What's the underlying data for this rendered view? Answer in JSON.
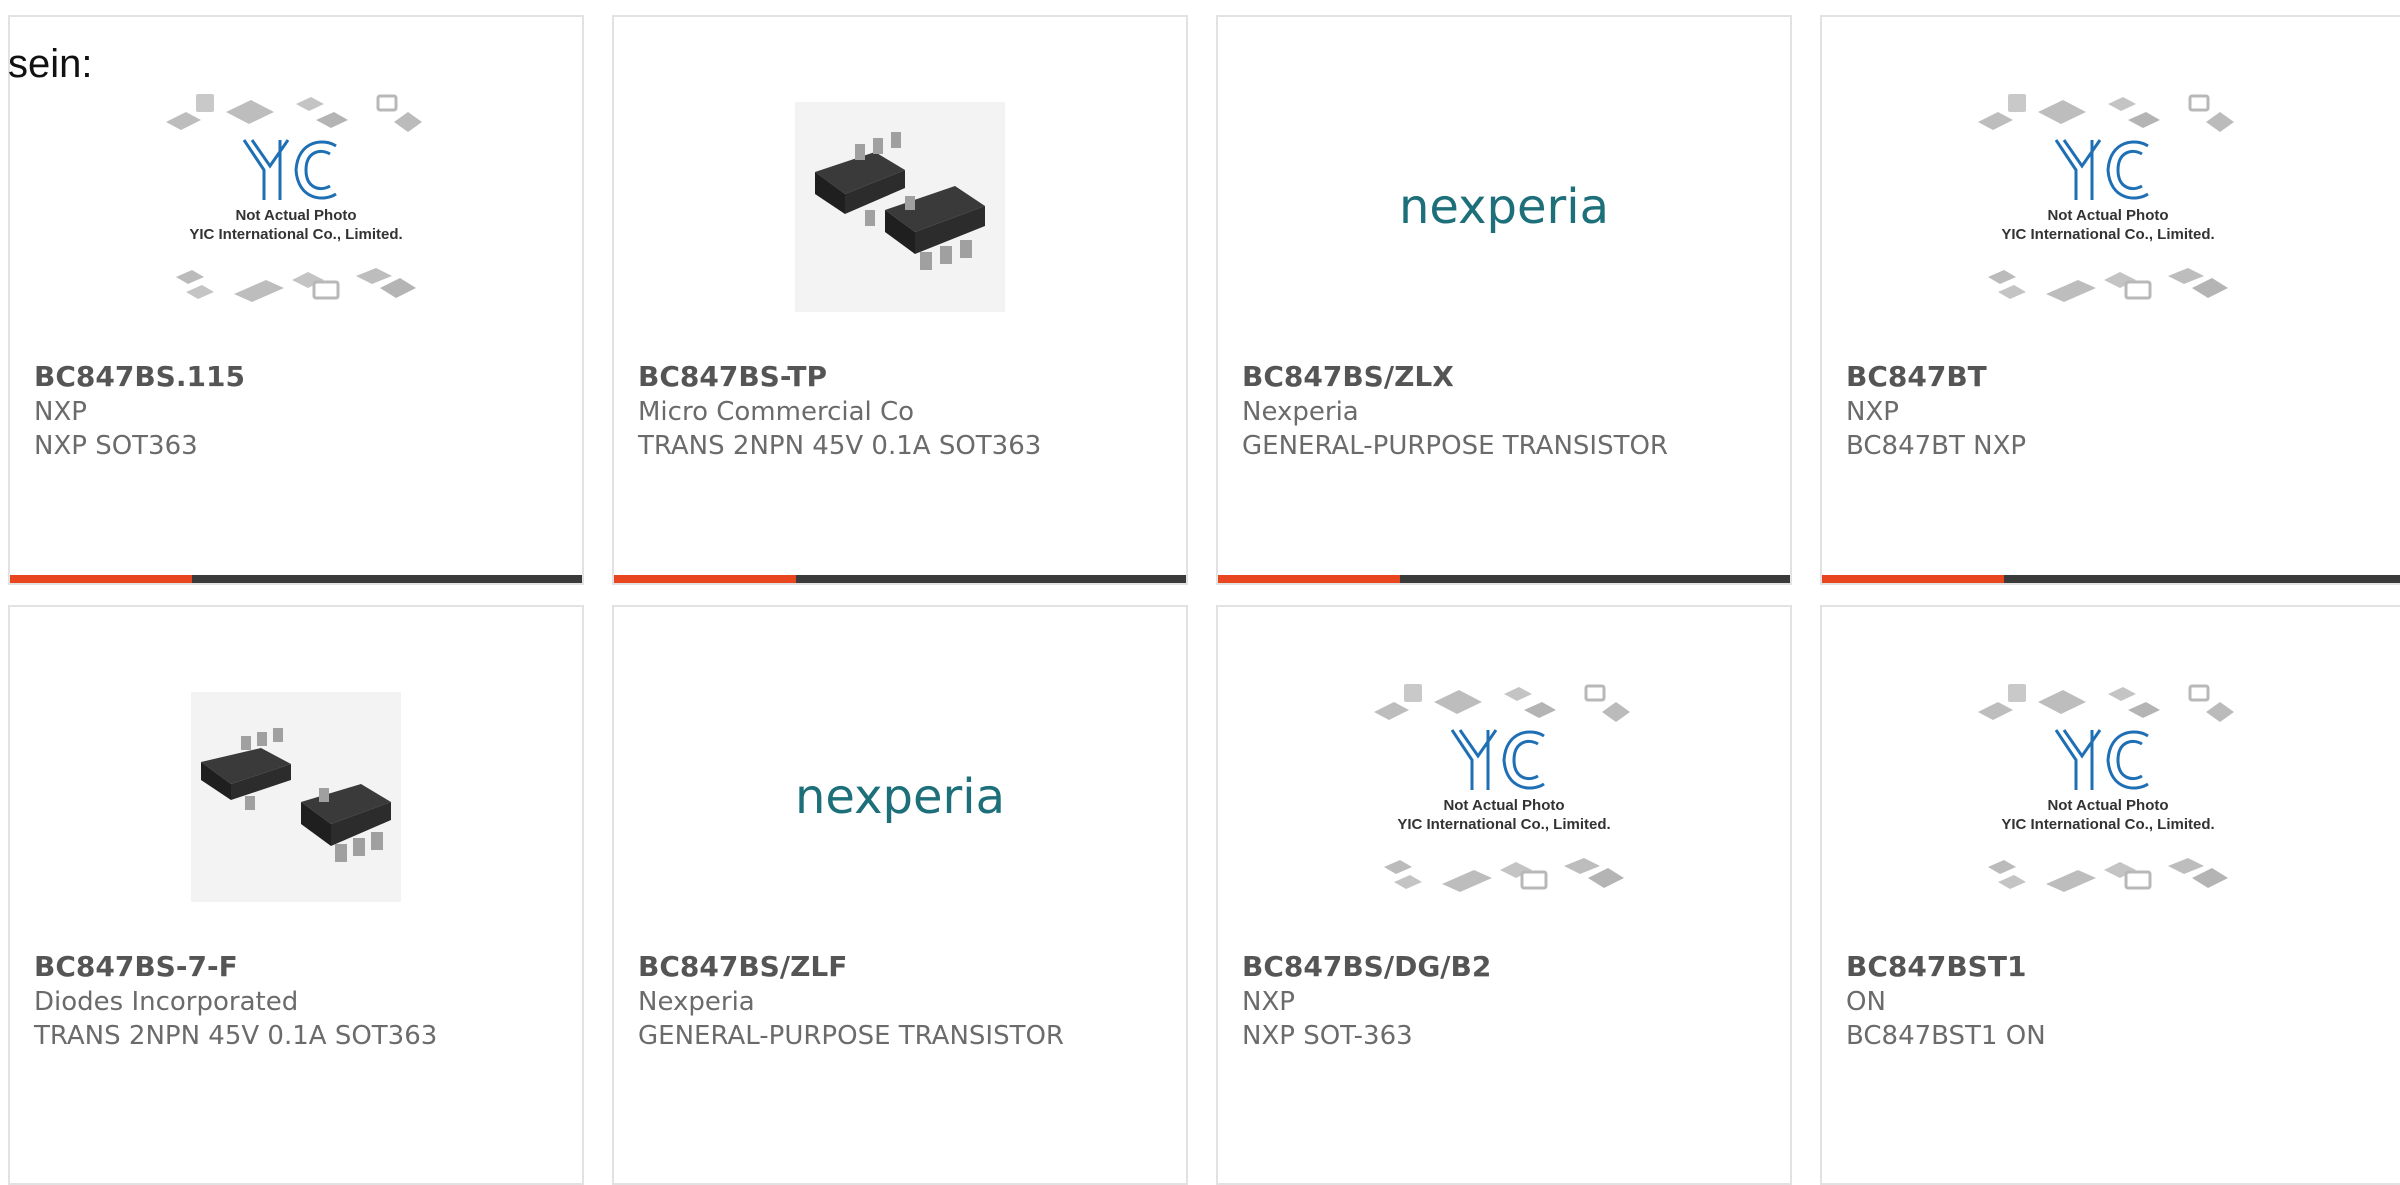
{
  "page": {
    "prefix_text": "sein:",
    "accent_color": "#e8461f",
    "bar_color": "#3a3a3a"
  },
  "cards": [
    {
      "part_number": "BC847BS.115",
      "manufacturer": "NXP",
      "description": "NXP SOT363",
      "image": "yic-placeholder",
      "image_caption_1": "Not Actual Photo",
      "image_caption_2": "YIC International Co., Limited."
    },
    {
      "part_number": "BC847BS-TP",
      "manufacturer": "Micro Commercial Co",
      "description": "TRANS 2NPN 45V 0.1A SOT363",
      "image": "sot363-photo"
    },
    {
      "part_number": "BC847BS/ZLX",
      "manufacturer": "Nexperia",
      "description": "GENERAL-PURPOSE TRANSISTOR",
      "image": "nexperia-logo",
      "logo_text": "nexperia"
    },
    {
      "part_number": "BC847BT",
      "manufacturer": "NXP",
      "description": "BC847BT NXP",
      "image": "yic-placeholder",
      "image_caption_1": "Not Actual Photo",
      "image_caption_2": "YIC International Co., Limited."
    },
    {
      "part_number": "BC847BS-7-F",
      "manufacturer": "Diodes Incorporated",
      "description": "TRANS 2NPN 45V 0.1A SOT363",
      "image": "sot363-photo"
    },
    {
      "part_number": "BC847BS/ZLF",
      "manufacturer": "Nexperia",
      "description": "GENERAL-PURPOSE TRANSISTOR",
      "image": "nexperia-logo",
      "logo_text": "nexperia"
    },
    {
      "part_number": "BC847BS/DG/B2",
      "manufacturer": "NXP",
      "description": "NXP SOT-363",
      "image": "yic-placeholder",
      "image_caption_1": "Not Actual Photo",
      "image_caption_2": "YIC International Co., Limited."
    },
    {
      "part_number": "BC847BST1",
      "manufacturer": "ON",
      "description": "BC847BST1 ON",
      "image": "yic-placeholder",
      "image_caption_1": "Not Actual Photo",
      "image_caption_2": "YIC International Co., Limited."
    }
  ]
}
